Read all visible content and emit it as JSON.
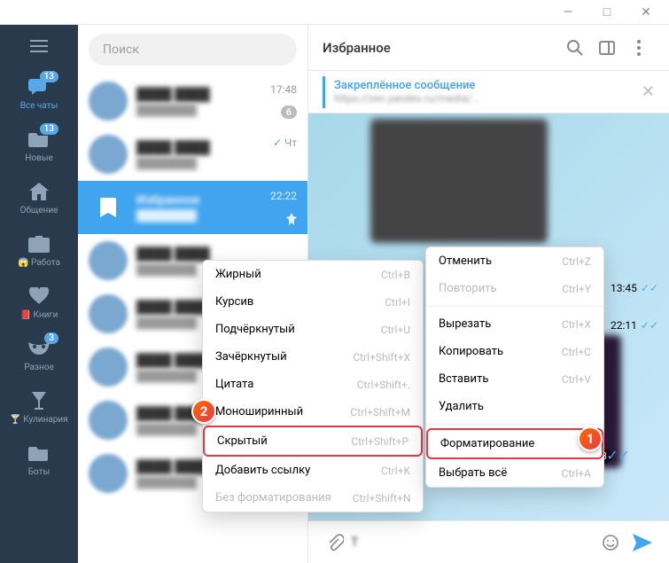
{
  "titlebar": {
    "min": "—",
    "max": "□",
    "close": "✕"
  },
  "search": {
    "placeholder": "Поиск"
  },
  "nav": [
    {
      "id": "all",
      "label": "Все чаты",
      "badge": "13",
      "active": true,
      "icon": "chats-icon"
    },
    {
      "id": "new",
      "label": "Новые",
      "badge": "13",
      "icon": "folder-icon"
    },
    {
      "id": "comm",
      "label": "Общение",
      "icon": "home-icon"
    },
    {
      "id": "work",
      "label": "Работа",
      "emoji": "😱",
      "icon": "briefcase-icon"
    },
    {
      "id": "books",
      "label": "Книги",
      "emoji": "📕",
      "icon": "heart-icon"
    },
    {
      "id": "misc",
      "label": "Разное",
      "badge": "3",
      "icon": "mask-icon"
    },
    {
      "id": "cook",
      "label": "Кулинария",
      "emoji": "🍸",
      "icon": "glass-icon"
    },
    {
      "id": "bots",
      "label": "Боты",
      "icon": "folder-icon"
    }
  ],
  "chats": [
    {
      "time": "17:48",
      "badge": "6"
    },
    {
      "time": "Чт",
      "check": true
    },
    {
      "time": "22:22",
      "selected": true,
      "pinned": true,
      "label": "Избранное"
    },
    {
      "time": ""
    },
    {
      "time": ""
    },
    {
      "time": ""
    },
    {
      "time": ""
    },
    {
      "time": ""
    }
  ],
  "header": {
    "title": "Избранное"
  },
  "pinned": {
    "title": "Закреплённое сообщение",
    "text": "https://zen.yandex.ru/media/..."
  },
  "msg_times": [
    "13:45",
    "22:11",
    "22:13"
  ],
  "input": {
    "text": "T"
  },
  "ctx_format": [
    {
      "label": "Жирный",
      "sc": "Ctrl+B"
    },
    {
      "label": "Курсив",
      "sc": "Ctrl+I"
    },
    {
      "label": "Подчёркнутый",
      "sc": "Ctrl+U"
    },
    {
      "label": "Зачёркнутый",
      "sc": "Ctrl+Shift+X"
    },
    {
      "label": "Цитата",
      "sc": "Ctrl+Shift+."
    },
    {
      "label": "Моноширинный",
      "sc": "Ctrl+Shift+M"
    },
    {
      "label": "Скрытый",
      "sc": "Ctrl+Shift+P",
      "hl": true
    },
    {
      "label": "Добавить ссылку",
      "sc": "Ctrl+K"
    },
    {
      "label": "Без форматирования",
      "sc": "Ctrl+Shift+N",
      "disabled": true
    }
  ],
  "ctx_main": [
    {
      "label": "Отменить",
      "sc": "Ctrl+Z"
    },
    {
      "label": "Повторить",
      "sc": "Ctrl+Y",
      "disabled": true
    },
    {
      "sep": true
    },
    {
      "label": "Вырезать",
      "sc": "Ctrl+X"
    },
    {
      "label": "Копировать",
      "sc": "Ctrl+C"
    },
    {
      "label": "Вставить",
      "sc": "Ctrl+V"
    },
    {
      "label": "Удалить",
      "sc": ""
    },
    {
      "sep": true
    },
    {
      "label": "Форматирование",
      "sc": "›",
      "hl": true
    },
    {
      "label": "Выбрать всё",
      "sc": "Ctrl+A"
    }
  ],
  "badges": {
    "b1": "1",
    "b2": "2"
  }
}
